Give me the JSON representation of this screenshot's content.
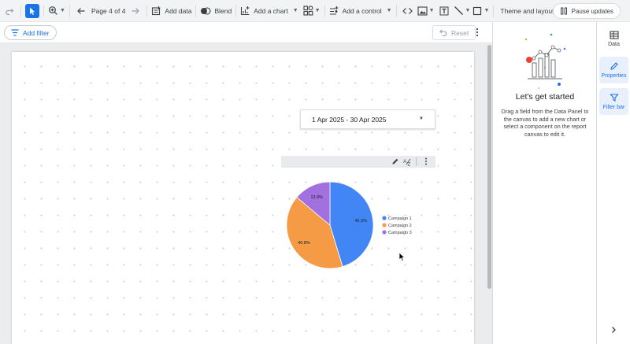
{
  "toolbar": {
    "page_indicator": "Page 4 of 4",
    "add_data": "Add data",
    "blend": "Blend",
    "add_chart": "Add a chart",
    "add_control": "Add a control",
    "theme_layout": "Theme and layout",
    "pause_updates": "Pause updates"
  },
  "filter_bar": {
    "add_filter": "Add filter",
    "reset": "Reset"
  },
  "canvas": {
    "date_range": "1 Apr 2025 - 30 Apr 2025"
  },
  "chart_data": {
    "type": "pie",
    "title": "",
    "categories": [
      "Campaign 1",
      "Campaign 2",
      "Campaign 3"
    ],
    "values": [
      45.3,
      40.8,
      13.9
    ],
    "labels": [
      "45.3%",
      "40.8%",
      "13.9%"
    ],
    "colors": [
      "#4285f4",
      "#f59b45",
      "#a370e0"
    ],
    "legend_position": "right"
  },
  "right_panel": {
    "title": "Let's get started",
    "description": "Drag a field from the Data Panel to the canvas to add a new chart or select a component on the report canvas to edit it."
  },
  "rail": {
    "data": "Data",
    "properties": "Properties",
    "filter_bar": "Filter bar"
  }
}
